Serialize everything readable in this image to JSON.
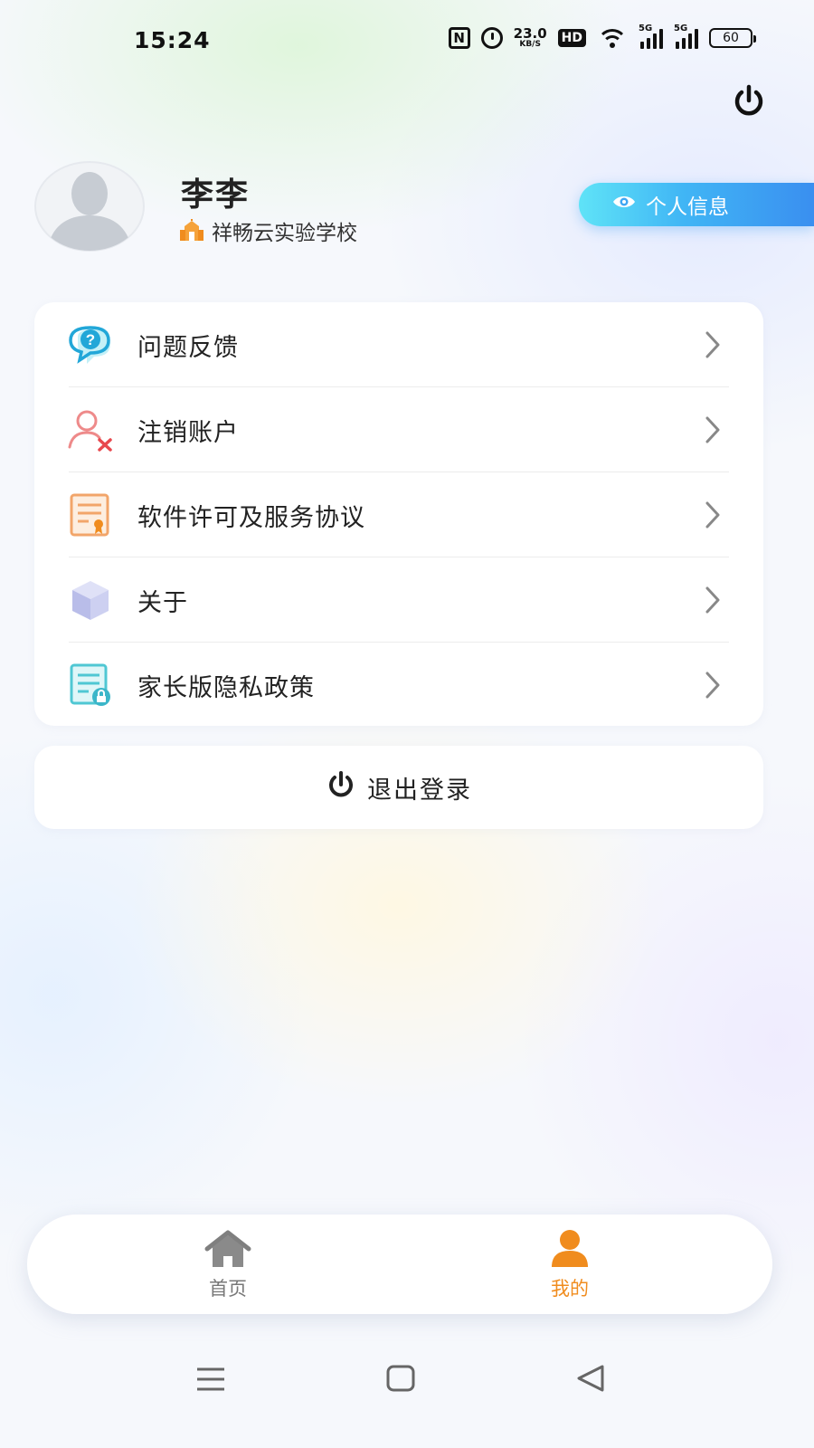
{
  "status_bar": {
    "time": "15:24",
    "nfc": "N",
    "net_speed_value": "23.0",
    "net_speed_unit": "KB/S",
    "hd_label": "HD",
    "sim1_label": "5G",
    "sim2_label": "5G",
    "battery": "60"
  },
  "profile": {
    "name": "李李",
    "school": "祥畅云实验学校",
    "info_button": "个人信息"
  },
  "menu": {
    "items": [
      {
        "label": "问题反馈",
        "icon": "feedback-question-icon"
      },
      {
        "label": "注销账户",
        "icon": "user-remove-icon"
      },
      {
        "label": "软件许可及服务协议",
        "icon": "certificate-icon"
      },
      {
        "label": "关于",
        "icon": "cube-icon"
      },
      {
        "label": "家长版隐私政策",
        "icon": "privacy-document-icon"
      }
    ]
  },
  "logout": {
    "label": "退出登录"
  },
  "tabs": [
    {
      "label": "首页",
      "icon": "home-icon",
      "active": false
    },
    {
      "label": "我的",
      "icon": "person-icon",
      "active": true
    }
  ],
  "colors": {
    "accent_orange": "#f08c1e",
    "info_button_start": "#5fe3f7",
    "info_button_end": "#3a8ff0",
    "text_primary": "#222222"
  }
}
